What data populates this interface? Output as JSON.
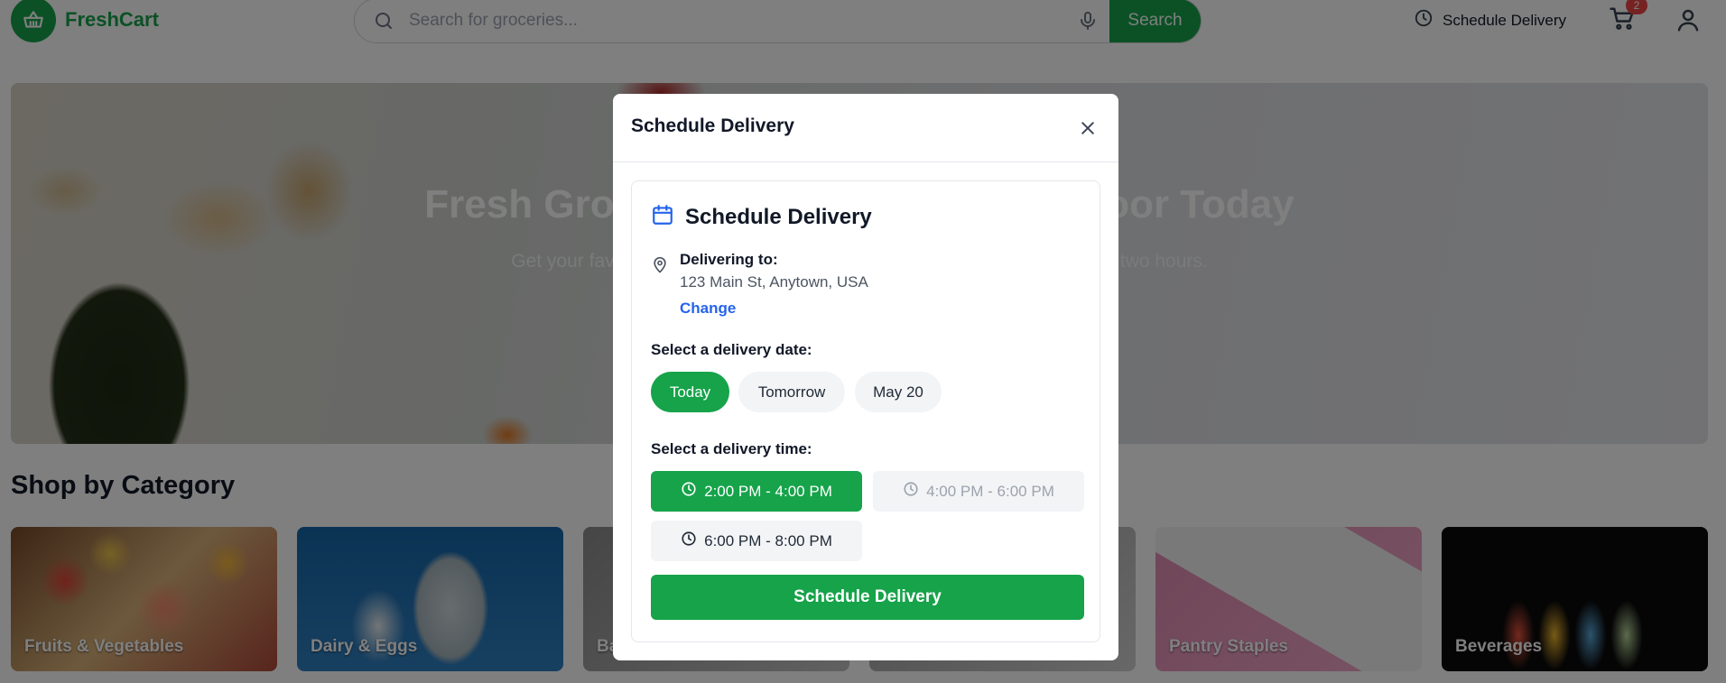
{
  "header": {
    "brand": "FreshCart",
    "search_placeholder": "Search for groceries...",
    "search_button": "Search",
    "schedule_link": "Schedule Delivery",
    "cart_count": "2"
  },
  "hero": {
    "title": "Fresh Groceries Delivered to Your Door Today",
    "subtitle": "Get your favorite groceries delivered fresh from local stores in as fast as two hours."
  },
  "categories": {
    "title": "Shop by Category",
    "items": [
      {
        "label": "Fruits & Vegetables"
      },
      {
        "label": "Dairy & Eggs"
      },
      {
        "label": "Bakery"
      },
      {
        "label": ""
      },
      {
        "label": "Pantry Staples"
      },
      {
        "label": "Beverages"
      }
    ]
  },
  "modal": {
    "title": "Schedule Delivery",
    "card_title": "Schedule Delivery",
    "delivering_label": "Delivering to:",
    "address": "123 Main St, Anytown, USA",
    "change_label": "Change",
    "date_label": "Select a delivery date:",
    "dates": [
      {
        "label": "Today",
        "selected": true
      },
      {
        "label": "Tomorrow",
        "selected": false
      },
      {
        "label": "May 20",
        "selected": false
      }
    ],
    "time_label": "Select a delivery time:",
    "times": [
      {
        "label": "2:00 PM - 4:00 PM",
        "state": "selected"
      },
      {
        "label": "4:00 PM - 6:00 PM",
        "state": "disabled"
      },
      {
        "label": "6:00 PM - 8:00 PM",
        "state": "available"
      }
    ],
    "submit_label": "Schedule Delivery"
  },
  "colors": {
    "brand_green": "#16a34a",
    "link_blue": "#2563eb",
    "badge_red": "#ef4444"
  },
  "icons": {
    "logo": "basket-icon",
    "search": "search-icon",
    "mic": "microphone-icon",
    "schedule": "clock-icon",
    "cart": "cart-icon",
    "user": "user-icon",
    "close": "close-icon",
    "calendar": "calendar-icon",
    "location": "map-pin-icon",
    "time_slot": "clock-icon"
  }
}
